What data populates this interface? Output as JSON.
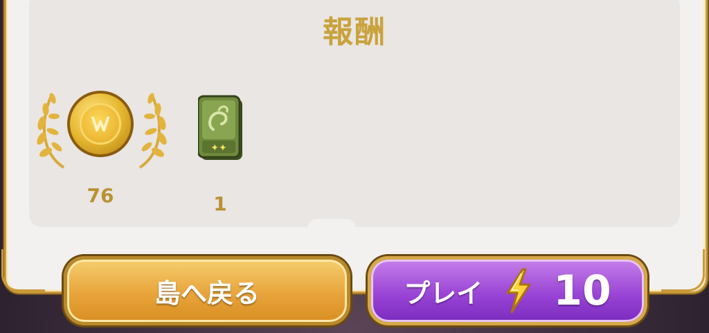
{
  "title": "報酬",
  "rewards": [
    {
      "name": "coin",
      "count": "76",
      "icon": "coin-icon"
    },
    {
      "name": "card",
      "count": "1",
      "icon": "card-pack-icon"
    }
  ],
  "buttons": {
    "back_to_island": "島へ戻る",
    "play": "プレイ",
    "play_cost": "10"
  },
  "colors": {
    "gold_text": "#c9a23c",
    "home_button": "#e8a43b",
    "play_button": "#9a45d6"
  }
}
